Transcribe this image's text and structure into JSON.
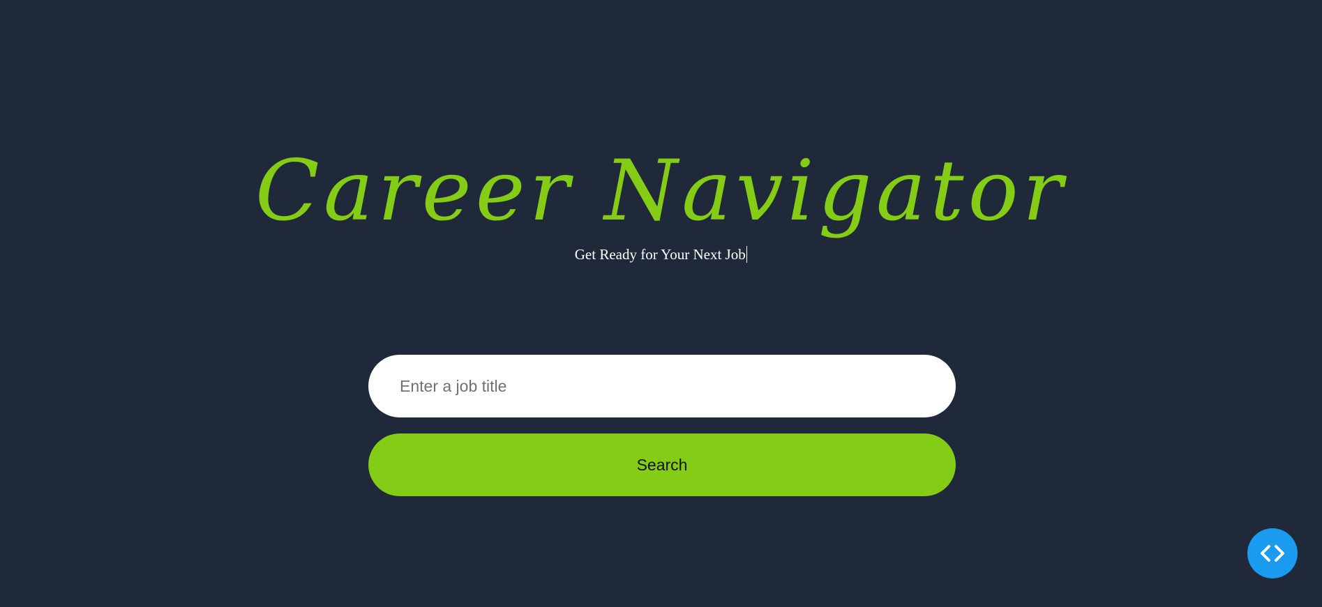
{
  "hero": {
    "title": "Career Navigator",
    "subtitle": "Get Ready for Your Next Job"
  },
  "search": {
    "placeholder": "Enter a job title",
    "value": "",
    "button_label": "Search"
  },
  "floating_action": {
    "icon": "code-icon"
  },
  "colors": {
    "background": "#1f293a",
    "accent": "#84cc16",
    "input_background": "#ffffff",
    "fab": "#1a9bf0"
  }
}
